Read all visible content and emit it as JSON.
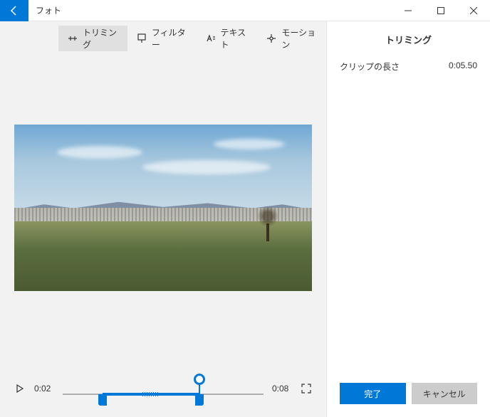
{
  "titlebar": {
    "title": "フォト"
  },
  "tabs": {
    "trimming": "トリミング",
    "filter": "フィルター",
    "text": "テキスト",
    "motion": "モーション"
  },
  "timeline": {
    "current": "0:02",
    "total": "0:08",
    "trim_start_pct": 20,
    "trim_end_pct": 68,
    "playhead_pct": 68
  },
  "panel": {
    "title": "トリミング",
    "clip_length_label": "クリップの長さ",
    "clip_length_value": "0:05.50"
  },
  "actions": {
    "done": "完了",
    "cancel": "キャンセル"
  }
}
